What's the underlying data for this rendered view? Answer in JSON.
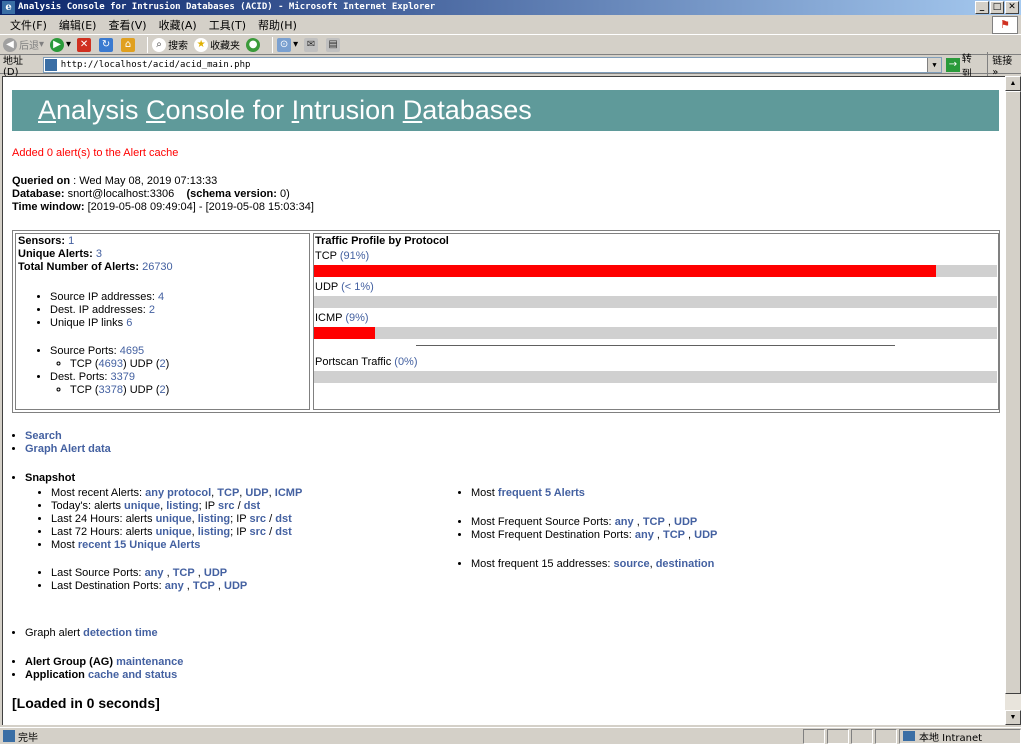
{
  "window": {
    "title": "Analysis Console for Intrusion Databases (ACID) - Microsoft Internet Explorer"
  },
  "menu": [
    "文件(F)",
    "编辑(E)",
    "查看(V)",
    "收藏(A)",
    "工具(T)",
    "帮助(H)"
  ],
  "toolbar": {
    "back": "后退",
    "search": "搜索",
    "favorites": "收藏夹"
  },
  "address": {
    "label": "地址(D)",
    "url": "http://localhost/acid/acid_main.php",
    "go": "转到",
    "links": "链接"
  },
  "status": {
    "text": "完毕",
    "zone": "本地 Intranet"
  },
  "page": {
    "banner": {
      "p1": "A",
      "p2": "nalysis ",
      "p3": "C",
      "p4": "onsole for ",
      "p5": "I",
      "p6": "ntrusion ",
      "p7": "D",
      "p8": "atabases"
    },
    "alert_cache_msg": "Added 0 alert(s) to the Alert cache",
    "queried_label": "Queried on",
    "queried_value": " : Wed May 08, 2019 07:13:33",
    "database_label": "Database:",
    "database_value": " snort@localhost:3306",
    "schema_label": "(schema version:",
    "schema_value": " 0)",
    "time_label": "Time window:",
    "time_value": " [2019-05-08 09:49:04] - [2019-05-08 15:03:34]",
    "summary": {
      "sensors_label": "Sensors:",
      "sensors": "1",
      "unique_label": "Unique Alerts:",
      "unique": "3",
      "total_label": "Total Number of Alerts:",
      "total": "26730",
      "src_ip_label": "Source IP addresses:",
      "src_ip": "4",
      "dst_ip_label": "Dest. IP addresses:",
      "dst_ip": "2",
      "ip_links_label": "Unique IP links",
      "ip_links": "6",
      "src_ports_label": "Source Ports:",
      "src_ports": "4695",
      "src_tcp": "4693",
      "src_udp": "2",
      "dst_ports_label": "Dest. Ports:",
      "dst_ports": "3379",
      "dst_tcp": "3378",
      "dst_udp": "2",
      "tcp_word": "TCP (",
      "udp_word": ")  UDP (",
      "close": ")"
    },
    "traffic": {
      "title": "Traffic Profile by Protocol",
      "tcp_label": "TCP",
      "tcp_pct": "(91%)",
      "tcp_fill": 0.91,
      "udp_label": "UDP",
      "udp_pct": "(< 1%)",
      "udp_fill": 0.0,
      "icmp_label": "ICMP",
      "icmp_pct": "(9%)",
      "icmp_fill": 0.09,
      "portscan_label": "Portscan Traffic",
      "portscan_pct": "(0%)",
      "portscan_fill": 0.0
    },
    "nav": {
      "search": "Search",
      "graph": "Graph Alert data"
    },
    "snapshot": {
      "title": "Snapshot",
      "recent_label": "Most recent Alerts:",
      "any_protocol": "any protocol",
      "tcp": "TCP",
      "udp": "UDP",
      "icmp": "ICMP",
      "today_label": "Today's: alerts",
      "l24_label": "Last 24 Hours: alerts",
      "l72_label": "Last 72 Hours: alerts",
      "unique": "unique",
      "listing": "listing",
      "ip_label": "; IP",
      "src": "src",
      "slash": "/",
      "dst": "dst",
      "most_label": "Most",
      "recent15": "recent 15 Unique Alerts",
      "last_src_label": "Last Source Ports:",
      "last_dst_label": "Last Destination Ports:",
      "any": "any",
      "freq5_pre": "Most",
      "freq5": "frequent 5 Alerts",
      "freq_src_label": "Most Frequent Source Ports:",
      "freq_dst_label": "Most Frequent Destination Ports:",
      "freq15_label": "Most frequent 15 addresses:",
      "source": "source",
      "destination": "destination"
    },
    "graph_time_label": "Graph alert",
    "graph_time_link": "detection time",
    "ag_label": "Alert Group (AG)",
    "ag_link": "maintenance",
    "app_label": "Application",
    "app_link": "cache and status",
    "loaded": "[Loaded in 0 seconds]"
  }
}
